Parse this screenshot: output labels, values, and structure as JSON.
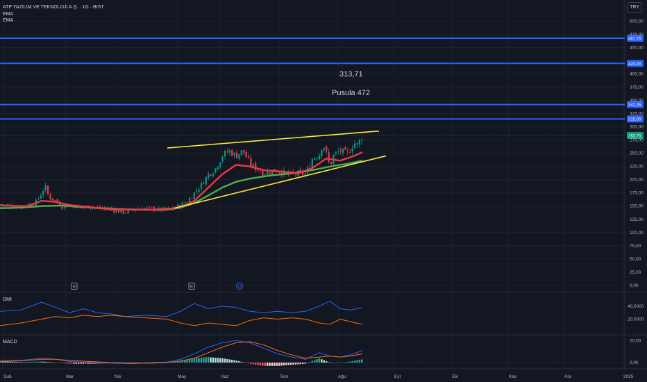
{
  "header": {
    "symbol_title": "ATP YAZILIM VE TEKNOLOJİ A.Ş. · 1G · BIST",
    "indicator_1": "EMA",
    "indicator_2": "EMA",
    "currency": "TRY"
  },
  "annotations": {
    "value_label": "313,71",
    "name_label": "Pusula 472"
  },
  "colors": {
    "background": "#131722",
    "up_candle": "#089981",
    "down_candle": "#f23645",
    "ema_fast": "#f23645",
    "ema_slow": "#4caf50",
    "hline": "#2962ff",
    "trendline": "#ffeb3b",
    "dmi_plus": "#2962ff",
    "dmi_minus": "#ff6d00",
    "macd_line": "#2962ff",
    "signal_line": "#ff6d00"
  },
  "chart_data": [
    {
      "type": "candlestick",
      "ylim": [
        -12,
        540
      ],
      "y_ticks": [
        "500,00",
        "475,00",
        "450,00",
        "400,00",
        "375,00",
        "350,00",
        "325,00",
        "300,00",
        "275,00",
        "250,00",
        "225,00",
        "200,00",
        "175,00",
        "150,00",
        "125,00",
        "100,00",
        "75,00",
        "50,00",
        "25,00",
        "0,00"
      ],
      "y_tick_values": [
        500,
        475,
        450,
        400,
        375,
        350,
        325,
        300,
        275,
        250,
        225,
        200,
        175,
        150,
        125,
        100,
        75,
        50,
        25,
        0
      ],
      "x_ticks": [
        "Şub",
        "Mar",
        "Nis",
        "May",
        "Haz",
        "Tem",
        "Ağu",
        "Eyl",
        "Eki",
        "Kas",
        "Ara",
        "2025"
      ],
      "horizontal_levels": [
        {
          "value": 467.75,
          "label": "467,75"
        },
        {
          "value": 420.0,
          "label": "420,00"
        },
        {
          "value": 342.25,
          "label": "342,25"
        },
        {
          "value": 315.0,
          "label": "315,00"
        }
      ],
      "last_price": {
        "value": 283.75,
        "label": "283,75"
      },
      "events": [
        "E",
        "E",
        "D"
      ],
      "close_anchors": [
        [
          0,
          148
        ],
        [
          10,
          152
        ],
        [
          20,
          151
        ],
        [
          30,
          150
        ],
        [
          40,
          153
        ],
        [
          50,
          154
        ],
        [
          60,
          175
        ],
        [
          65,
          188
        ],
        [
          70,
          168
        ],
        [
          80,
          160
        ],
        [
          90,
          148
        ],
        [
          100,
          152
        ],
        [
          110,
          150
        ],
        [
          120,
          148
        ],
        [
          130,
          150
        ],
        [
          140,
          146
        ],
        [
          150,
          145
        ],
        [
          160,
          144
        ],
        [
          170,
          140
        ],
        [
          180,
          138
        ],
        [
          190,
          142
        ],
        [
          200,
          145
        ],
        [
          210,
          146
        ],
        [
          220,
          145
        ],
        [
          230,
          143
        ],
        [
          240,
          144
        ],
        [
          250,
          146
        ],
        [
          260,
          152
        ],
        [
          270,
          160
        ],
        [
          280,
          175
        ],
        [
          290,
          190
        ],
        [
          300,
          210
        ],
        [
          310,
          220
        ],
        [
          320,
          245
        ],
        [
          330,
          255
        ],
        [
          340,
          245
        ],
        [
          350,
          255
        ],
        [
          360,
          230
        ],
        [
          370,
          220
        ],
        [
          380,
          212
        ],
        [
          390,
          216
        ],
        [
          400,
          218
        ],
        [
          410,
          212
        ],
        [
          420,
          210
        ],
        [
          430,
          212
        ],
        [
          440,
          210
        ],
        [
          450,
          240
        ],
        [
          460,
          248
        ],
        [
          465,
          270
        ],
        [
          470,
          250
        ],
        [
          475,
          225
        ],
        [
          480,
          245
        ],
        [
          490,
          255
        ],
        [
          500,
          248
        ],
        [
          510,
          270
        ],
        [
          515,
          265
        ],
        [
          522,
          284
        ]
      ],
      "ema_fast_anchors": [
        [
          0,
          152
        ],
        [
          20,
          150
        ],
        [
          40,
          150
        ],
        [
          60,
          160
        ],
        [
          80,
          158
        ],
        [
          100,
          152
        ],
        [
          130,
          148
        ],
        [
          160,
          144
        ],
        [
          200,
          143
        ],
        [
          240,
          144
        ],
        [
          260,
          148
        ],
        [
          280,
          160
        ],
        [
          300,
          185
        ],
        [
          320,
          210
        ],
        [
          340,
          228
        ],
        [
          360,
          225
        ],
        [
          380,
          218
        ],
        [
          400,
          216
        ],
        [
          430,
          212
        ],
        [
          450,
          222
        ],
        [
          470,
          240
        ],
        [
          490,
          236
        ],
        [
          510,
          245
        ],
        [
          522,
          252
        ]
      ],
      "ema_slow_anchors": [
        [
          0,
          146
        ],
        [
          30,
          147
        ],
        [
          60,
          150
        ],
        [
          90,
          151
        ],
        [
          120,
          148
        ],
        [
          150,
          146
        ],
        [
          180,
          144
        ],
        [
          210,
          143
        ],
        [
          240,
          143
        ],
        [
          260,
          147
        ],
        [
          280,
          156
        ],
        [
          300,
          170
        ],
        [
          320,
          185
        ],
        [
          340,
          196
        ],
        [
          360,
          202
        ],
        [
          390,
          208
        ],
        [
          420,
          212
        ],
        [
          450,
          218
        ],
        [
          480,
          226
        ],
        [
          500,
          230
        ],
        [
          522,
          236
        ]
      ],
      "trendlines": [
        {
          "x1": 241,
          "y1": 260,
          "x2": 546,
          "y2": 292
        },
        {
          "x1": 251,
          "y1": 146,
          "x2": 556,
          "y2": 245
        }
      ]
    },
    {
      "type": "line",
      "title": "DMI",
      "y_ticks": [
        "40,0000",
        "20,0000"
      ],
      "y_tick_values": [
        40,
        20
      ],
      "ylim": [
        -2,
        58
      ],
      "series": [
        {
          "anchors": [
            [
              0,
              32
            ],
            [
              30,
              34
            ],
            [
              60,
              46
            ],
            [
              80,
              38
            ],
            [
              100,
              30
            ],
            [
              120,
              36
            ],
            [
              140,
              30
            ],
            [
              160,
              28
            ],
            [
              180,
              24
            ],
            [
              210,
              26
            ],
            [
              240,
              24
            ],
            [
              260,
              32
            ],
            [
              280,
              44
            ],
            [
              300,
              36
            ],
            [
              320,
              40
            ],
            [
              340,
              38
            ],
            [
              360,
              32
            ],
            [
              380,
              30
            ],
            [
              400,
              32
            ],
            [
              420,
              30
            ],
            [
              440,
              32
            ],
            [
              460,
              40
            ],
            [
              475,
              48
            ],
            [
              490,
              36
            ],
            [
              505,
              34
            ],
            [
              522,
              38
            ]
          ]
        },
        {
          "anchors": [
            [
              0,
              10
            ],
            [
              30,
              14
            ],
            [
              60,
              20
            ],
            [
              80,
              24
            ],
            [
              100,
              22
            ],
            [
              120,
              26
            ],
            [
              140,
              24
            ],
            [
              160,
              26
            ],
            [
              180,
              24
            ],
            [
              210,
              22
            ],
            [
              240,
              20
            ],
            [
              260,
              14
            ],
            [
              280,
              10
            ],
            [
              300,
              14
            ],
            [
              320,
              12
            ],
            [
              340,
              10
            ],
            [
              360,
              18
            ],
            [
              380,
              22
            ],
            [
              400,
              20
            ],
            [
              420,
              22
            ],
            [
              440,
              20
            ],
            [
              460,
              14
            ],
            [
              475,
              12
            ],
            [
              490,
              20
            ],
            [
              505,
              16
            ],
            [
              522,
              12
            ]
          ]
        }
      ]
    },
    {
      "type": "bar",
      "title": "MACD",
      "y_ticks": [
        "20,00",
        "0,00"
      ],
      "y_tick_values": [
        20,
        0
      ],
      "ylim": [
        -5,
        24
      ],
      "macd_anchors": [
        [
          0,
          2
        ],
        [
          30,
          2
        ],
        [
          60,
          4
        ],
        [
          80,
          3
        ],
        [
          100,
          1
        ],
        [
          130,
          0
        ],
        [
          160,
          -0.5
        ],
        [
          190,
          -1
        ],
        [
          220,
          0
        ],
        [
          240,
          0.5
        ],
        [
          260,
          3
        ],
        [
          280,
          8
        ],
        [
          300,
          14
        ],
        [
          320,
          18
        ],
        [
          340,
          20
        ],
        [
          360,
          18
        ],
        [
          380,
          13
        ],
        [
          400,
          8
        ],
        [
          420,
          5
        ],
        [
          440,
          3
        ],
        [
          460,
          9
        ],
        [
          475,
          6
        ],
        [
          490,
          5
        ],
        [
          505,
          7
        ],
        [
          522,
          11
        ]
      ],
      "signal_anchors": [
        [
          0,
          1
        ],
        [
          30,
          1.5
        ],
        [
          60,
          3
        ],
        [
          80,
          3
        ],
        [
          100,
          2
        ],
        [
          130,
          1
        ],
        [
          160,
          0
        ],
        [
          190,
          -0.5
        ],
        [
          220,
          -0.5
        ],
        [
          240,
          0
        ],
        [
          260,
          1.5
        ],
        [
          280,
          4
        ],
        [
          300,
          9
        ],
        [
          320,
          14
        ],
        [
          340,
          18
        ],
        [
          360,
          19
        ],
        [
          380,
          16
        ],
        [
          400,
          11
        ],
        [
          420,
          7
        ],
        [
          440,
          4
        ],
        [
          460,
          5
        ],
        [
          475,
          6
        ],
        [
          490,
          5
        ],
        [
          505,
          6
        ],
        [
          522,
          8
        ]
      ]
    }
  ]
}
